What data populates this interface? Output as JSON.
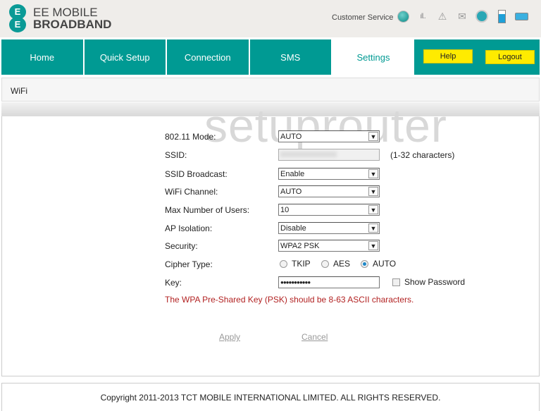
{
  "header": {
    "logo_letters": "EE",
    "brand_line1": "EE MOBILE",
    "brand_line2": "BROADBAND",
    "customer_service": "Customer Service",
    "status_icons": [
      "connection-status-icon",
      "signal-icon",
      "warning-icon",
      "message-icon",
      "wifi-icon",
      "battery-icon",
      "device-icon"
    ]
  },
  "nav": {
    "tabs": [
      {
        "label": "Home"
      },
      {
        "label": "Quick Setup"
      },
      {
        "label": "Connection"
      },
      {
        "label": "SMS"
      },
      {
        "label": "Settings",
        "active": true
      }
    ],
    "help": "Help",
    "logout": "Logout"
  },
  "section_title": "WiFi",
  "watermark": "setuprouter",
  "form": {
    "mode": {
      "label": "802.11 Mode:",
      "value": "AUTO"
    },
    "ssid": {
      "label": "SSID:",
      "value": "",
      "hint": "(1-32 characters)"
    },
    "broadcast": {
      "label": "SSID Broadcast:",
      "value": "Enable"
    },
    "channel": {
      "label": "WiFi Channel:",
      "value": "AUTO"
    },
    "max_users": {
      "label": "Max Number of Users:",
      "value": "10"
    },
    "ap_isolation": {
      "label": "AP Isolation:",
      "value": "Disable"
    },
    "security": {
      "label": "Security:",
      "value": "WPA2 PSK"
    },
    "cipher": {
      "label": "Cipher Type:",
      "options": [
        "TKIP",
        "AES",
        "AUTO"
      ],
      "selected": "AUTO"
    },
    "key": {
      "label": "Key:",
      "value": "●●●●●●●●●●●",
      "show_password": "Show Password"
    },
    "error": "The WPA Pre-Shared Key (PSK) should be 8-63 ASCII characters.",
    "apply": "Apply",
    "cancel": "Cancel"
  },
  "footer": "Copyright 2011-2013 TCT MOBILE INTERNATIONAL LIMITED. ALL RIGHTS RESERVED.",
  "colors": {
    "teal": "#009a93",
    "yellow": "#ffeb00",
    "error": "#b22222"
  }
}
